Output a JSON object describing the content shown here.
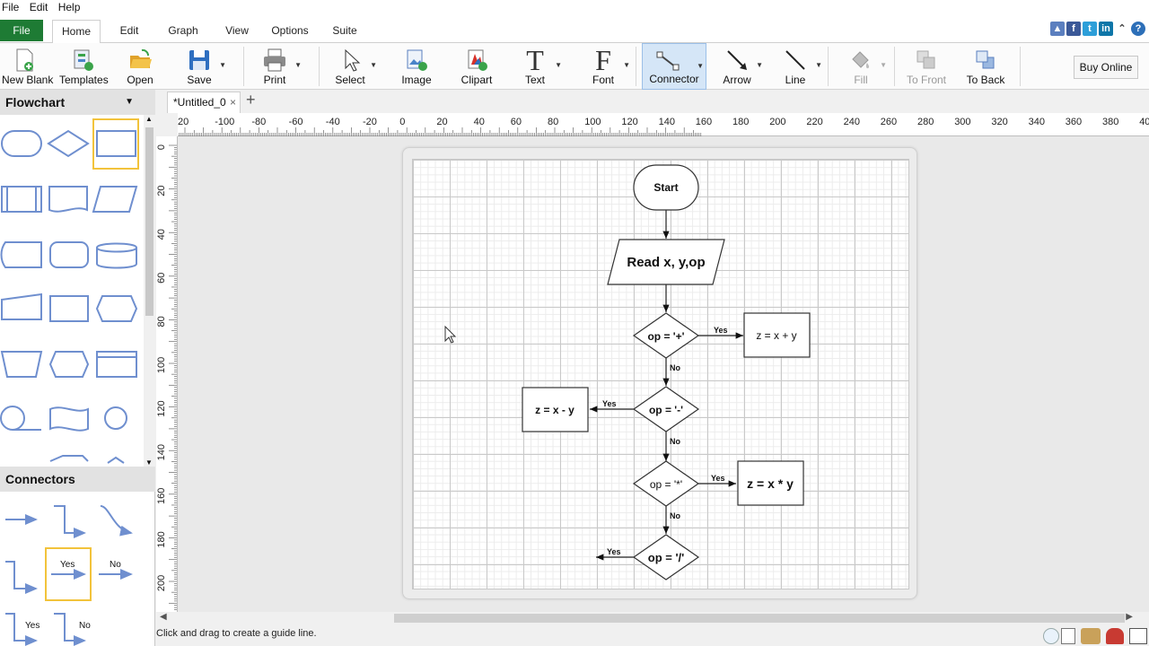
{
  "menu": [
    "File",
    "Edit",
    "Help"
  ],
  "tabs": {
    "file": "File",
    "items": [
      "Home",
      "Edit",
      "Graph",
      "View",
      "Options",
      "Suite"
    ],
    "active": "Home"
  },
  "ribbon": {
    "new_blank": "New Blank",
    "templates": "Templates",
    "open": "Open",
    "save": "Save",
    "print": "Print",
    "select": "Select",
    "image": "Image",
    "clipart": "Clipart",
    "text": "Text",
    "font": "Font",
    "connector": "Connector",
    "arrow": "Arrow",
    "line": "Line",
    "fill": "Fill",
    "to_front": "To Front",
    "to_back": "To Back",
    "buy_online": "Buy Online"
  },
  "left_panel": {
    "flowchart_title": "Flowchart",
    "connectors_title": "Connectors",
    "connector_labels": {
      "yes": "Yes",
      "no": "No"
    }
  },
  "document": {
    "tab_title": "*Untitled_0",
    "close": "×",
    "add": "+"
  },
  "ruler": {
    "h_labels": [
      "20",
      "-100",
      "-80",
      "-60",
      "-40",
      "-20",
      "0",
      "20",
      "40",
      "60",
      "80",
      "100",
      "120",
      "140",
      "160",
      "180",
      "200",
      "220",
      "240",
      "260",
      "280",
      "300",
      "320",
      "340",
      "360",
      "380",
      "40"
    ],
    "v_labels": [
      "0",
      "20",
      "40",
      "60",
      "80",
      "100",
      "120",
      "140",
      "160",
      "180",
      "200",
      "20"
    ]
  },
  "flowchart": {
    "start": "Start",
    "read": "Read x, y,op",
    "d1": "op = '+'",
    "p1": "z = x + y",
    "d2": "op = '-'",
    "p2": "z = x - y",
    "d3": "op = '*'",
    "p3": "z = x * y",
    "d4": "op = '/'",
    "yes": "Yes",
    "no": "No"
  },
  "colors": {
    "file_tab": "#1e7b34",
    "shape_stroke": "#6f8fcf",
    "selection": "#f2c33b",
    "connector_active": "#d5e6f7"
  },
  "status": "Click and drag to create a guide line."
}
